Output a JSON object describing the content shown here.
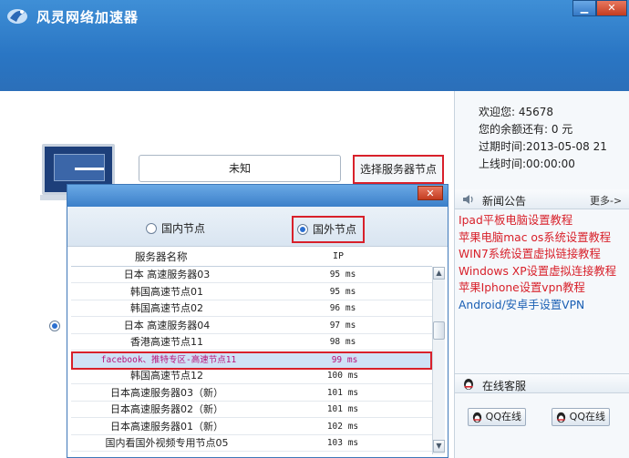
{
  "app": {
    "title": "风灵网络加速器",
    "minimize_label": "▁",
    "close_label": "✕"
  },
  "main": {
    "status_value": "未知",
    "select_server_label": "选择服务器节点"
  },
  "user": {
    "welcome": "欢迎您: 45678",
    "balance": "您的余额还有: 0 元",
    "expire": "过期时间:2013-05-08 21",
    "online_time": "上线时间:00:00:00"
  },
  "news": {
    "title": "新闻公告",
    "more": "更多->",
    "items": [
      {
        "label": "Ipad平板电脑设置教程",
        "color": "#d8202a"
      },
      {
        "label": "苹果电脑mac os系统设置教程",
        "color": "#d8202a"
      },
      {
        "label": "WIN7系统设置虚拟链接教程",
        "color": "#d8202a"
      },
      {
        "label": "Windows XP设置虚拟连接教程",
        "color": "#d8202a"
      },
      {
        "label": "苹果Iphone设置vpn教程",
        "color": "#d8202a"
      },
      {
        "label": "Android/安卓手设置VPN",
        "color": "#1a5fb4"
      }
    ]
  },
  "service": {
    "title": "在线客服",
    "qq_buttons": [
      "QQ在线",
      "QQ在线"
    ]
  },
  "popup": {
    "close_label": "✕",
    "tab_domestic": "国内节点",
    "tab_foreign": "国外节点",
    "selected_tab": "国外节点",
    "col_name": "服务器名称",
    "col_ip": "IP",
    "rows": [
      {
        "name": "日本 高速服务器03",
        "ip": "95 ms"
      },
      {
        "name": "韩国高速节点01",
        "ip": "95 ms"
      },
      {
        "name": "韩国高速节点02",
        "ip": "96 ms"
      },
      {
        "name": "日本 高速服务器04",
        "ip": "97 ms"
      },
      {
        "name": "香港高速节点11",
        "ip": "98 ms"
      },
      {
        "name": "facebook、推特专区-高速节点11",
        "ip": "99 ms",
        "highlight": true
      },
      {
        "name": "韩国高速节点12",
        "ip": "100 ms"
      },
      {
        "name": "日本高速服务器03（新）",
        "ip": "101 ms"
      },
      {
        "name": "日本高速服务器02（新）",
        "ip": "101 ms"
      },
      {
        "name": "日本高速服务器01（新）",
        "ip": "102 ms"
      },
      {
        "name": "国内看国外视频专用节点05",
        "ip": "103 ms"
      }
    ]
  },
  "colors": {
    "accent": "#2b76c4",
    "highlight_border": "#d8202a",
    "news_red": "#d8202a",
    "news_blue": "#1a5fb4"
  }
}
